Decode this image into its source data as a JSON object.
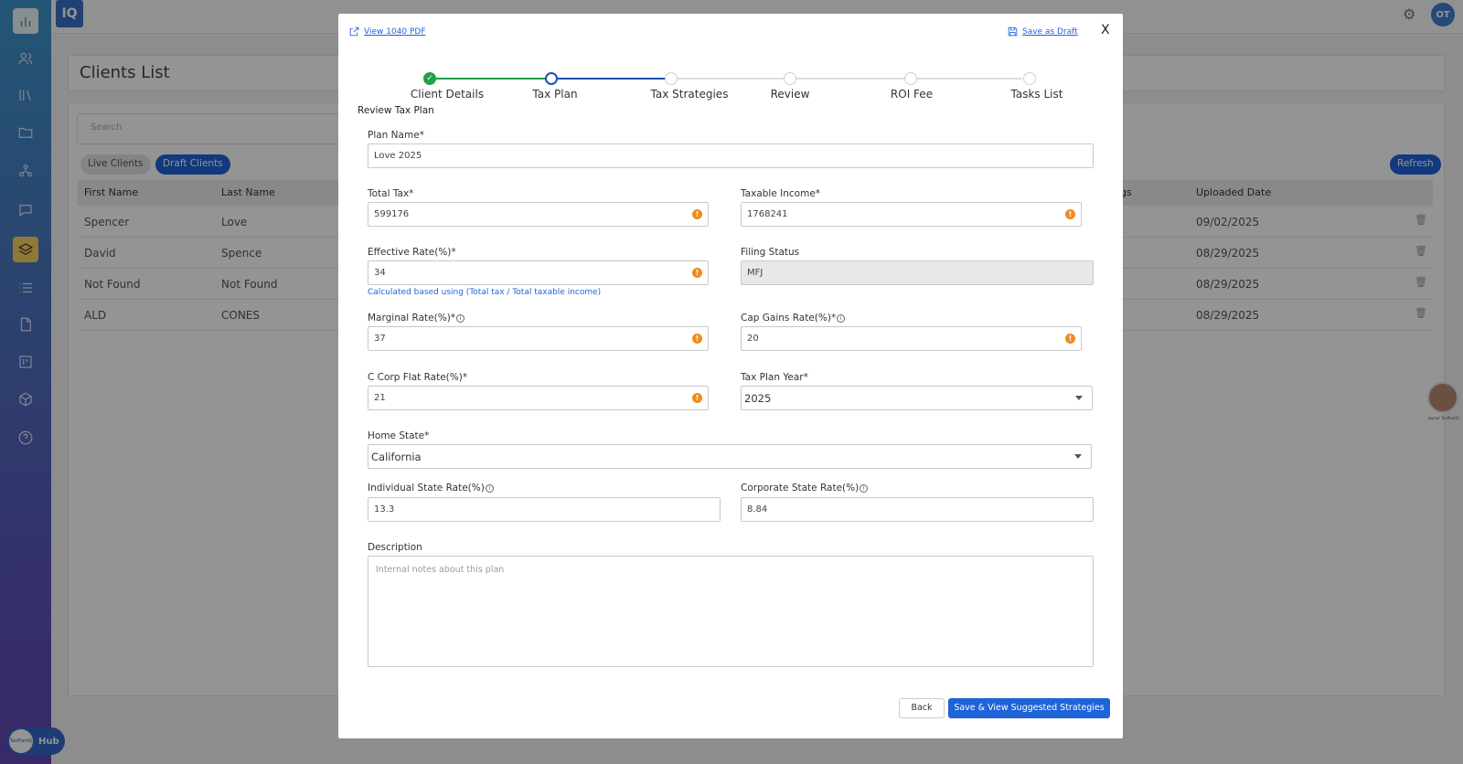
{
  "app": {
    "brand": "IQ"
  },
  "topbar": {
    "user_initials": "OT"
  },
  "hub": {
    "label": "Hub",
    "logo_text": "TaxPlanIQ"
  },
  "background_page": {
    "title": "Clients List",
    "search_placeholder": "Search",
    "chips": {
      "live": "Live Clients",
      "draft": "Draft Clients"
    },
    "refresh_label": "Refresh",
    "columns": {
      "first_name": "First Name",
      "last_name": "Last Name",
      "savings_partial": "gs",
      "uploaded_date": "Uploaded Date"
    },
    "rows": [
      {
        "first": "Spencer",
        "last": "Love",
        "date": "09/02/2025"
      },
      {
        "first": "David",
        "last": "Spence",
        "date": "08/29/2025"
      },
      {
        "first": "Not Found",
        "last": "Not Found",
        "date": "08/29/2025"
      },
      {
        "first": "ALD",
        "last": "CONES",
        "date": "08/29/2025"
      }
    ],
    "float_label": "Joyner TaxPlanIQ"
  },
  "modal": {
    "view_pdf": "View 1040 PDF",
    "save_draft": "Save as Draft",
    "close": "X",
    "steps": [
      {
        "label": "Client Details",
        "state": "done"
      },
      {
        "label": "Tax Plan",
        "state": "current"
      },
      {
        "label": "Tax Strategies",
        "state": "pending"
      },
      {
        "label": "Review",
        "state": "pending"
      },
      {
        "label": "ROI Fee",
        "state": "pending"
      },
      {
        "label": "Tasks List",
        "state": "pending"
      }
    ],
    "section_title": "Review Tax Plan",
    "plan_name": {
      "label": "Plan Name*",
      "value": "Love 2025"
    },
    "total_tax": {
      "label": "Total Tax*",
      "value": "599176"
    },
    "taxable_income": {
      "label": "Taxable Income*",
      "value": "1768241"
    },
    "effective_rate": {
      "label": "Effective Rate(%)*",
      "value": "34",
      "hint": "Calculated based using (Total tax / Total taxable income)"
    },
    "filing_status": {
      "label": "Filing Status",
      "value": "MFJ"
    },
    "marginal_rate": {
      "label": "Marginal Rate(%)*",
      "value": "37"
    },
    "cap_gains_rate": {
      "label": "Cap Gains Rate(%)*",
      "value": "20"
    },
    "c_corp_rate": {
      "label": "C Corp Flat Rate(%)*",
      "value": "21"
    },
    "tax_plan_year": {
      "label": "Tax Plan Year*",
      "value": "2025"
    },
    "home_state": {
      "label": "Home State*",
      "value": "California"
    },
    "individual_state_rate": {
      "label": "Individual State Rate(%)",
      "value": "13.3"
    },
    "corporate_state_rate": {
      "label": "Corporate State Rate(%)",
      "value": "8.84"
    },
    "description": {
      "label": "Description",
      "placeholder": "Internal notes about this plan"
    },
    "back_label": "Back",
    "save_label": "Save & View Suggested Strategies"
  },
  "colors": {
    "primary": "#1f63d8",
    "success": "#22a04a",
    "warning": "#f08b1c",
    "active_nav": "#f4d35e"
  }
}
